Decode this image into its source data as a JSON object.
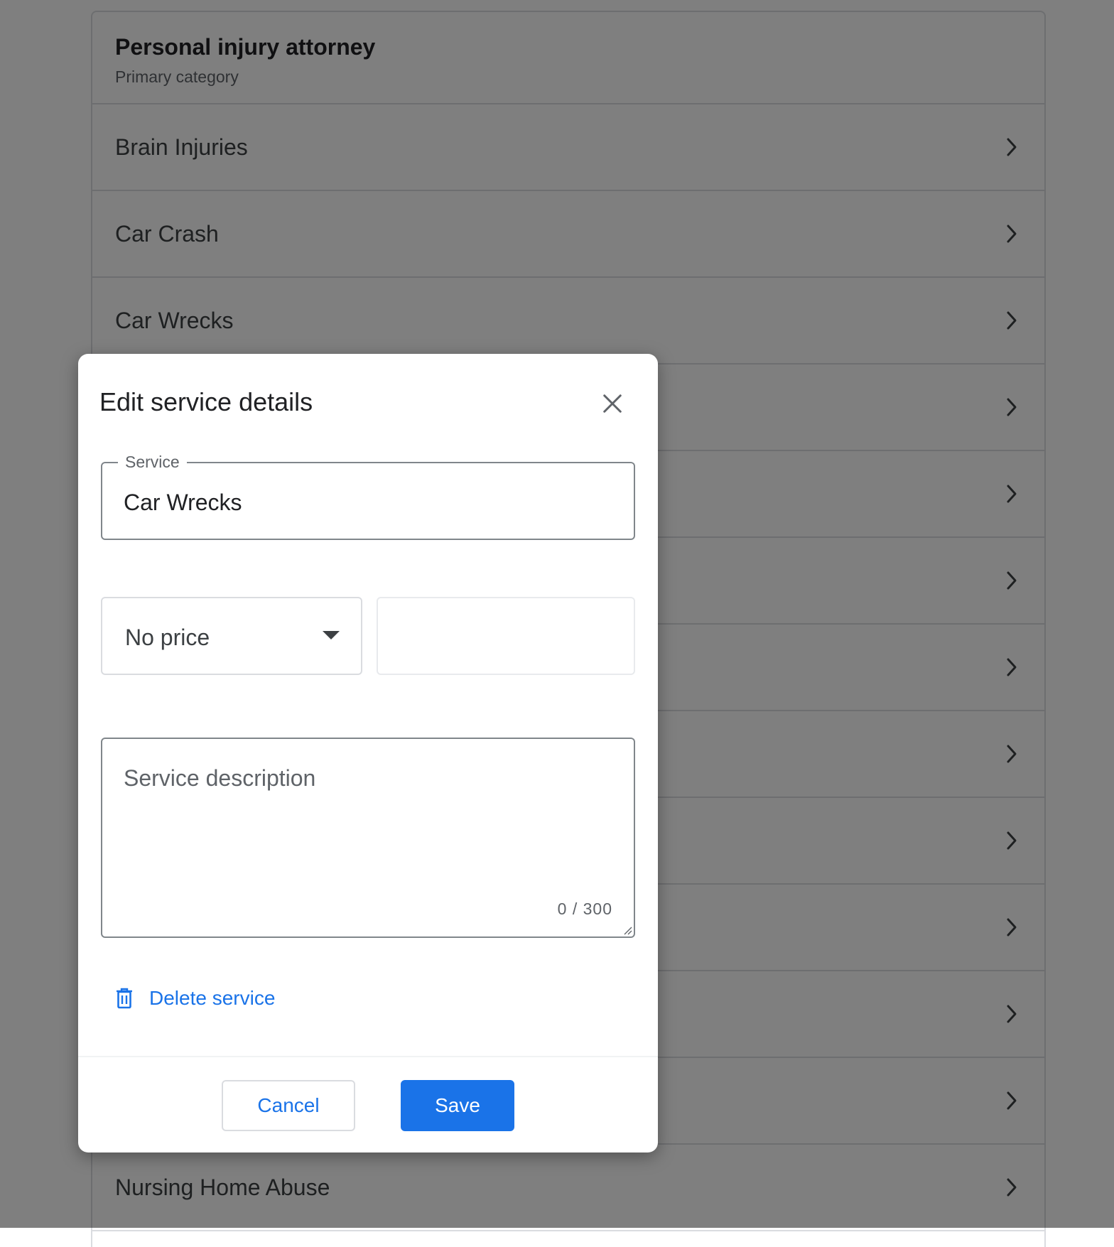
{
  "background": {
    "category_title": "Personal injury attorney",
    "category_subtitle": "Primary category",
    "services": [
      {
        "label": "Brain Injuries"
      },
      {
        "label": "Car Crash"
      },
      {
        "label": "Car Wrecks"
      },
      {
        "label": ""
      },
      {
        "label": ""
      },
      {
        "label": ""
      },
      {
        "label": ""
      },
      {
        "label": ""
      },
      {
        "label": ""
      },
      {
        "label": ""
      },
      {
        "label": ""
      },
      {
        "label": ""
      },
      {
        "label": "Nursing Home Abuse"
      }
    ],
    "row_icon": "chevron-right-icon"
  },
  "dialog": {
    "title": "Edit service details",
    "close_icon": "close-icon",
    "service_field": {
      "label": "Service",
      "value": "Car Wrecks"
    },
    "price_select": {
      "selected": "No price",
      "icon": "dropdown-caret-icon"
    },
    "price_input": {
      "value": ""
    },
    "description": {
      "placeholder": "Service description",
      "counter": "0 / 300"
    },
    "delete": {
      "label": "Delete service",
      "icon": "trash-icon"
    },
    "footer": {
      "cancel_label": "Cancel",
      "save_label": "Save"
    }
  },
  "colors": {
    "accent": "#1a73e8",
    "text_primary": "#202124",
    "text_secondary": "#5f6368",
    "divider": "#dadce0"
  }
}
